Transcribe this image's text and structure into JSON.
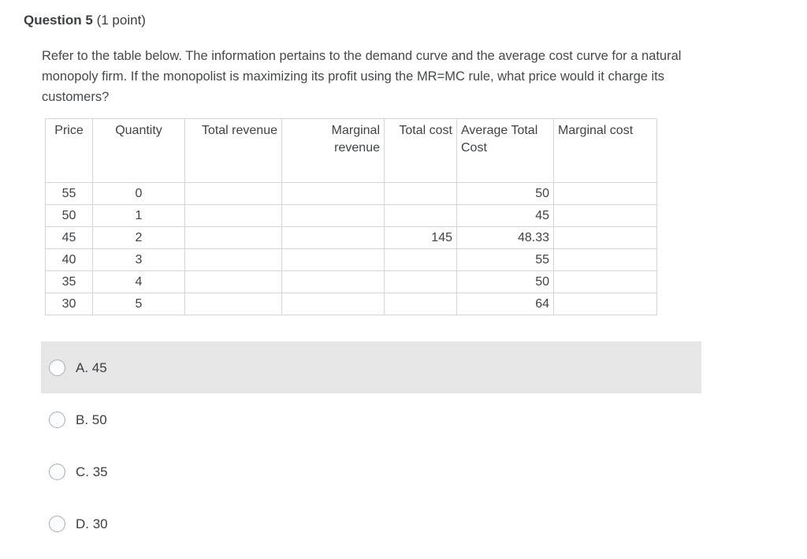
{
  "question": {
    "label": "Question 5",
    "points": "(1 point)",
    "text": "Refer to the table below. The information pertains to the demand curve and the average cost curve for a natural monopoly firm. If the monopolist is maximizing its profit using the MR=MC rule, what price would it charge its customers?"
  },
  "table": {
    "headers": [
      "Price",
      "Quantity",
      "Total revenue",
      "Marginal revenue",
      "Total cost",
      "Average Total Cost",
      "Marginal cost"
    ],
    "rows": [
      {
        "price": "55",
        "quantity": "0",
        "total_revenue": "",
        "marginal_revenue": "",
        "total_cost": "",
        "average_total_cost": "50",
        "marginal_cost": ""
      },
      {
        "price": "50",
        "quantity": "1",
        "total_revenue": "",
        "marginal_revenue": "",
        "total_cost": "",
        "average_total_cost": "45",
        "marginal_cost": ""
      },
      {
        "price": "45",
        "quantity": "2",
        "total_revenue": "",
        "marginal_revenue": "",
        "total_cost": "145",
        "average_total_cost": "48.33",
        "marginal_cost": ""
      },
      {
        "price": "40",
        "quantity": "3",
        "total_revenue": "",
        "marginal_revenue": "",
        "total_cost": "",
        "average_total_cost": "55",
        "marginal_cost": ""
      },
      {
        "price": "35",
        "quantity": "4",
        "total_revenue": "",
        "marginal_revenue": "",
        "total_cost": "",
        "average_total_cost": "50",
        "marginal_cost": ""
      },
      {
        "price": "30",
        "quantity": "5",
        "total_revenue": "",
        "marginal_revenue": "",
        "total_cost": "",
        "average_total_cost": "64",
        "marginal_cost": ""
      }
    ]
  },
  "options": [
    {
      "label": "A. 45",
      "highlighted": true,
      "selected": false
    },
    {
      "label": "B. 50",
      "highlighted": false,
      "selected": false
    },
    {
      "label": "C. 35",
      "highlighted": false,
      "selected": false
    },
    {
      "label": "D. 30",
      "highlighted": false,
      "selected": false
    }
  ],
  "colors": {
    "text": "#43464a",
    "table_border": "#d3d5d7",
    "table_outer_border": "#c0c2c4",
    "highlight_background": "#e6e6e6",
    "radio_border": "#a9adb3"
  }
}
